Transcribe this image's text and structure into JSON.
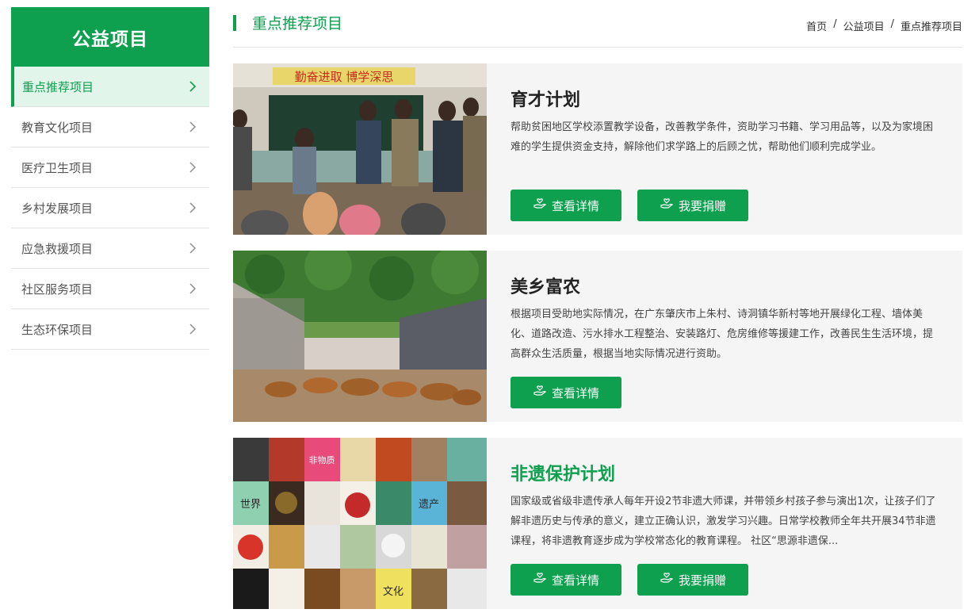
{
  "sidebar": {
    "title": "公益项目",
    "items": [
      {
        "label": "重点推荐项目"
      },
      {
        "label": "教育文化项目"
      },
      {
        "label": "医疗卫生项目"
      },
      {
        "label": "乡村发展项目"
      },
      {
        "label": "应急救援项目"
      },
      {
        "label": "社区服务项目"
      },
      {
        "label": "生态环保项目"
      }
    ]
  },
  "header": {
    "title": "重点推荐项目",
    "breadcrumb": [
      "首页",
      "公益项目",
      "重点推荐项目"
    ]
  },
  "projects": [
    {
      "title": "育才计划",
      "desc": "帮助贫困地区学校添置教学设备，改善教学条件，资助学习书籍、学习用品等，以及为家境困难的学生提供资金支持，解除他们求学路上的后顾之忧，帮助他们顺利完成学业。",
      "detail_label": "查看详情",
      "donate_label": "我要捐赠"
    },
    {
      "title": "美乡富农",
      "desc": "根据项目受助地实际情况，在广东肇庆市上朱村、诗洞镇华新村等地开展绿化工程、墙体美化、道路改造、污水排水工程整治、安装路灯、危房维修等援建工作，改善民生生活环境，提高群众生活质量，根据当地实际情况进行资助。",
      "detail_label": "查看详情"
    },
    {
      "title": "非遗保护计划",
      "desc": "国家级或省级非遗传承人每年开设2节非遗大师课，并带领乡村孩子参与演出1次，让孩子们了解非遗历史与传承的意义，建立正确认识，激发学习兴趣。日常学校教师全年共开展34节非遗课程，将非遗教育逐步成为学校常态化的教育课程。 社区“思源非遗保...",
      "detail_label": "查看详情",
      "donate_label": "我要捐赠"
    }
  ],
  "classroom_banner": "勤奋进取  博学深思",
  "mosaic_words": [
    "非物质",
    "世界",
    "遗产",
    "文化"
  ],
  "colors": {
    "accent": "#0e9f4f",
    "card_bg": "#f5f5f5"
  }
}
